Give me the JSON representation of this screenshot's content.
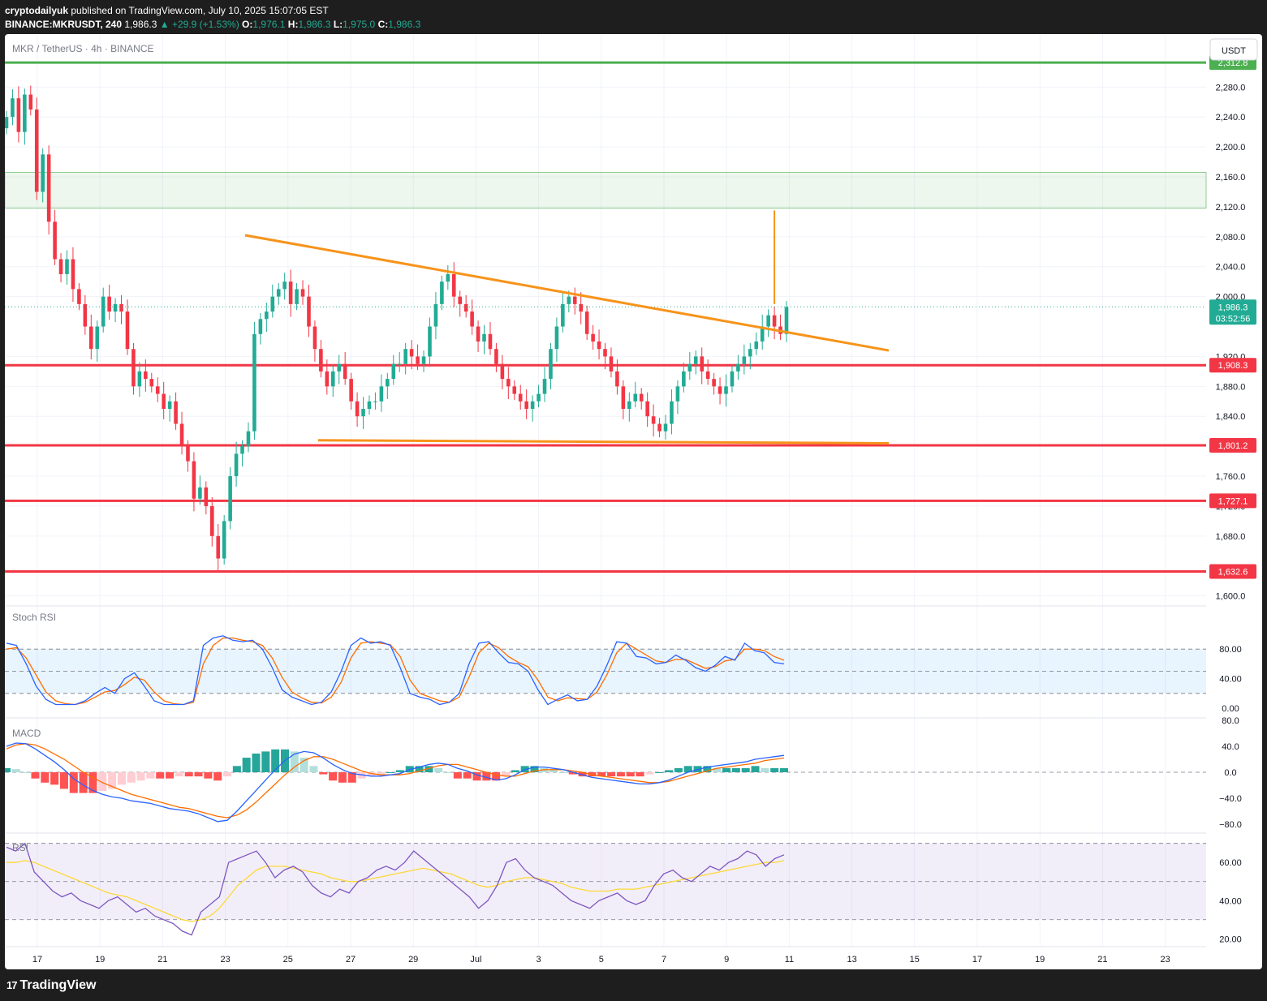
{
  "header": {
    "author": "cryptodailyuk",
    "published_text": "published on TradingView.com, July 10, 2025 15:07:05 EST",
    "symbol": "BINANCE:MKRUSDT, 240",
    "last": "1,986.3",
    "change": "▲ +29.9 (+1.53%)",
    "o_label": "O:",
    "o_value": "1,976.1",
    "h_label": "H:",
    "h_value": "1,986.3",
    "l_label": "L:",
    "l_value": "1,975.0",
    "c_label": "C:",
    "c_value": "1,986.3"
  },
  "chart_title": "MKR / TetherUS · 4h · BINANCE",
  "currency_button": "USDT",
  "footer": {
    "logo_text": "TradingView",
    "logo_mark": "17"
  },
  "colors": {
    "up": "#22ab94",
    "down": "#f23645",
    "orange": "#f7931a",
    "green_line": "#4caf50",
    "support": "#f23645",
    "stoch_k": "#2962ff",
    "stoch_d": "#ff6d00",
    "macd": "#2962ff",
    "signal": "#ff6d00",
    "rsi": "#7e57c2",
    "rsi_ma": "#fdd835"
  },
  "chart_data": [
    {
      "type": "candlestick",
      "title": "MKR / TetherUS · 4h · BINANCE",
      "ylim": [
        1592,
        2340
      ],
      "y_ticks": [
        1600,
        1680,
        1720,
        1760,
        1840,
        1880,
        1920,
        2000,
        2040,
        2080,
        2120,
        2160,
        2200,
        2240,
        2280
      ],
      "y_tick_labels": [
        "1,600.0",
        "1,680.0",
        "1,720.0",
        "1,760.0",
        "1,840.0",
        "1,880.0",
        "1,920.0",
        "2,000.0",
        "2,040.0",
        "2,080.0",
        "2,120.0",
        "2,160.0",
        "2,200.0",
        "2,240.0",
        "2,280.0"
      ],
      "x_labels": [
        "17",
        "19",
        "21",
        "23",
        "25",
        "27",
        "29",
        "Jul",
        "3",
        "5",
        "7",
        "9",
        "11",
        "13",
        "15",
        "17",
        "19",
        "21",
        "23"
      ],
      "current_price": {
        "value": 1986.3,
        "label": "1,986.3",
        "countdown": "03:52:56"
      },
      "horizontal_levels": [
        {
          "value": 2312.8,
          "label": "2,312.8",
          "color": "#4caf50"
        },
        {
          "value": 1908.3,
          "label": "1,908.3",
          "color": "#f23645"
        },
        {
          "value": 1801.2,
          "label": "1,801.2",
          "color": "#f23645"
        },
        {
          "value": 1727.1,
          "label": "1,727.1",
          "color": "#f23645"
        },
        {
          "value": 1632.6,
          "label": "1,632.6",
          "color": "#f23645"
        }
      ],
      "zone": {
        "from": 2118,
        "to": 2166
      },
      "trendlines": [
        {
          "from": [
            "Jun 24",
            2082
          ],
          "to": [
            "Jul 14",
            1928
          ]
        },
        {
          "from": [
            "Jun 26",
            1808
          ],
          "to": [
            "Jul 14",
            1804
          ]
        }
      ],
      "closes": [
        2240,
        2265,
        2220,
        2270,
        2250,
        2140,
        2190,
        2100,
        2050,
        2030,
        2050,
        2010,
        1990,
        1960,
        1930,
        1960,
        2000,
        1980,
        1990,
        1980,
        1930,
        1880,
        1900,
        1890,
        1880,
        1870,
        1850,
        1860,
        1830,
        1800,
        1780,
        1730,
        1745,
        1720,
        1680,
        1650,
        1700,
        1760,
        1790,
        1800,
        1820,
        1950,
        1970,
        1980,
        2000,
        2010,
        2020,
        1990,
        2010,
        2000,
        1960,
        1930,
        1900,
        1880,
        1900,
        1910,
        1890,
        1860,
        1840,
        1850,
        1860,
        1860,
        1880,
        1890,
        1910,
        1910,
        1930,
        1920,
        1910,
        1920,
        1960,
        1990,
        2020,
        2030,
        2000,
        1990,
        1980,
        1960,
        1940,
        1950,
        1930,
        1910,
        1890,
        1880,
        1870,
        1860,
        1850,
        1860,
        1870,
        1890,
        1930,
        1960,
        1990,
        2000,
        1990,
        1980,
        1950,
        1940,
        1930,
        1920,
        1900,
        1880,
        1850,
        1860,
        1870,
        1860,
        1840,
        1830,
        1820,
        1830,
        1860,
        1880,
        1900,
        1910,
        1920,
        1900,
        1890,
        1880,
        1870,
        1880,
        1900,
        1910,
        1920,
        1930,
        1940,
        1960,
        1975,
        1960,
        1950,
        1986
      ]
    },
    {
      "type": "line",
      "title": "Stoch RSI",
      "ylim": [
        0,
        100
      ],
      "y_ticks": [
        0,
        40,
        80
      ],
      "y_tick_labels": [
        "0.00",
        "40.00",
        "80.00"
      ],
      "bands": [
        20,
        50,
        80
      ],
      "series": [
        {
          "name": "K",
          "values": [
            88,
            85,
            60,
            30,
            12,
            5,
            5,
            5,
            10,
            20,
            28,
            20,
            40,
            48,
            30,
            10,
            5,
            5,
            5,
            10,
            85,
            95,
            98,
            92,
            90,
            92,
            80,
            55,
            25,
            15,
            10,
            5,
            8,
            22,
            50,
            85,
            95,
            88,
            90,
            85,
            55,
            20,
            15,
            12,
            5,
            8,
            20,
            60,
            88,
            90,
            75,
            62,
            60,
            50,
            25,
            5,
            12,
            18,
            10,
            12,
            30,
            58,
            90,
            88,
            70,
            68,
            60,
            62,
            72,
            65,
            55,
            50,
            58,
            70,
            65,
            88,
            78,
            75,
            62,
            60
          ]
        },
        {
          "name": "D",
          "values": [
            80,
            82,
            68,
            45,
            22,
            10,
            6,
            5,
            8,
            15,
            22,
            24,
            32,
            42,
            38,
            22,
            10,
            6,
            5,
            8,
            60,
            85,
            95,
            95,
            92,
            90,
            85,
            68,
            42,
            22,
            14,
            8,
            7,
            15,
            35,
            68,
            88,
            90,
            88,
            86,
            70,
            38,
            20,
            15,
            10,
            8,
            15,
            42,
            75,
            88,
            82,
            70,
            62,
            56,
            38,
            15,
            10,
            14,
            13,
            12,
            22,
            45,
            75,
            88,
            80,
            72,
            64,
            62,
            66,
            66,
            60,
            54,
            56,
            64,
            66,
            80,
            80,
            78,
            70,
            65
          ]
        }
      ]
    },
    {
      "type": "bar",
      "title": "MACD",
      "ylim": [
        -80,
        80
      ],
      "y_ticks": [
        -80,
        -40,
        0,
        40,
        80
      ],
      "y_tick_labels": [
        "−80.0",
        "−40.0",
        "0.0",
        "40.0",
        "80.0"
      ],
      "series": [
        {
          "name": "MACD",
          "values": [
            40,
            45,
            44,
            36,
            26,
            16,
            4,
            -10,
            -20,
            -28,
            -34,
            -38,
            -40,
            -44,
            -46,
            -48,
            -52,
            -56,
            -58,
            -60,
            -64,
            -70,
            -76,
            -74,
            -60,
            -44,
            -28,
            -12,
            4,
            18,
            28,
            32,
            30,
            22,
            12,
            4,
            -2,
            -4,
            -6,
            -6,
            -4,
            -2,
            4,
            8,
            12,
            14,
            12,
            6,
            2,
            -4,
            -8,
            -12,
            -10,
            -4,
            4,
            8,
            8,
            6,
            4,
            0,
            -4,
            -8,
            -10,
            -12,
            -14,
            -16,
            -18,
            -18,
            -16,
            -12,
            -6,
            0,
            4,
            8,
            10,
            12,
            14,
            16,
            20,
            22,
            24,
            26
          ]
        },
        {
          "name": "Signal",
          "values": [
            36,
            42,
            44,
            42,
            36,
            28,
            20,
            10,
            0,
            -8,
            -16,
            -22,
            -28,
            -34,
            -38,
            -42,
            -46,
            -50,
            -54,
            -56,
            -60,
            -64,
            -68,
            -70,
            -66,
            -58,
            -46,
            -32,
            -18,
            -4,
            8,
            18,
            24,
            24,
            20,
            14,
            8,
            2,
            -2,
            -4,
            -4,
            -4,
            -2,
            2,
            6,
            10,
            12,
            12,
            8,
            4,
            0,
            -4,
            -6,
            -6,
            -2,
            2,
            4,
            4,
            4,
            2,
            0,
            -4,
            -6,
            -8,
            -10,
            -12,
            -14,
            -16,
            -16,
            -14,
            -10,
            -6,
            -2,
            2,
            6,
            8,
            10,
            12,
            14,
            18,
            20,
            22
          ]
        }
      ]
    },
    {
      "type": "line",
      "title": "RSI",
      "ylim": [
        18,
        72
      ],
      "y_ticks": [
        20,
        40,
        60
      ],
      "y_tick_labels": [
        "20.00",
        "40.00",
        "60.00"
      ],
      "bands": [
        30,
        50,
        70
      ],
      "series": [
        {
          "name": "RSI",
          "values": [
            68,
            66,
            70,
            55,
            50,
            45,
            42,
            44,
            40,
            38,
            36,
            40,
            42,
            38,
            34,
            36,
            32,
            30,
            28,
            24,
            22,
            34,
            38,
            42,
            60,
            62,
            64,
            66,
            60,
            52,
            56,
            58,
            55,
            48,
            44,
            42,
            46,
            44,
            50,
            52,
            56,
            58,
            56,
            60,
            66,
            62,
            58,
            54,
            50,
            46,
            42,
            36,
            40,
            48,
            60,
            62,
            56,
            52,
            50,
            48,
            44,
            40,
            38,
            36,
            40,
            42,
            44,
            40,
            38,
            40,
            48,
            54,
            56,
            52,
            50,
            54,
            58,
            56,
            60,
            62,
            66,
            64,
            58,
            62,
            64
          ]
        },
        {
          "name": "RSI MA",
          "values": [
            60,
            60,
            61,
            60,
            58,
            56,
            54,
            52,
            50,
            48,
            46,
            44,
            43,
            42,
            40,
            38,
            36,
            34,
            32,
            30,
            29,
            30,
            32,
            36,
            42,
            48,
            52,
            56,
            58,
            58,
            58,
            57,
            56,
            55,
            54,
            52,
            51,
            50,
            50,
            51,
            52,
            53,
            54,
            55,
            56,
            57,
            56,
            55,
            54,
            52,
            50,
            48,
            47,
            48,
            50,
            51,
            52,
            52,
            51,
            50,
            49,
            47,
            46,
            45,
            45,
            45,
            46,
            46,
            46,
            47,
            48,
            49,
            50,
            51,
            52,
            53,
            54,
            55,
            56,
            57,
            58,
            59,
            60,
            60,
            61
          ]
        }
      ]
    }
  ]
}
